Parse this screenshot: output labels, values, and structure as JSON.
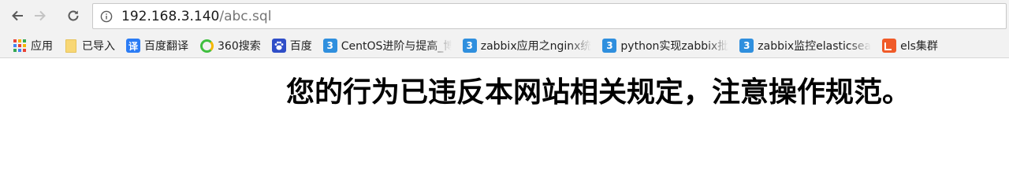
{
  "browser": {
    "address_bar": {
      "host": "192.168.3.140",
      "path": "/abc.sql"
    },
    "bookmarks": [
      {
        "label": "应用",
        "icon": "apps-grid-icon"
      },
      {
        "label": "已导入",
        "icon": "folder-icon"
      },
      {
        "label": "百度翻译",
        "icon": "baidu-fanyi-icon"
      },
      {
        "label": "360搜索",
        "icon": "360-search-icon"
      },
      {
        "label": "百度",
        "icon": "baidu-paw-icon"
      },
      {
        "label": "CentOS进阶与提高_博",
        "icon": "cnblogs-icon"
      },
      {
        "label": "zabbix应用之nginx统",
        "icon": "cnblogs-icon"
      },
      {
        "label": "python实现zabbix批",
        "icon": "cnblogs-icon"
      },
      {
        "label": "zabbix监控elasticsea",
        "icon": "cnblogs-icon"
      },
      {
        "label": "els集群",
        "icon": "els-icon"
      }
    ]
  },
  "page": {
    "message": "您的行为已违反本网站相关规定，注意操作规范。"
  },
  "colors": {
    "chrome_bg": "#f2f2f2",
    "url_host": "#1a1a1a",
    "url_path": "#757575",
    "message_text": "#000000"
  }
}
